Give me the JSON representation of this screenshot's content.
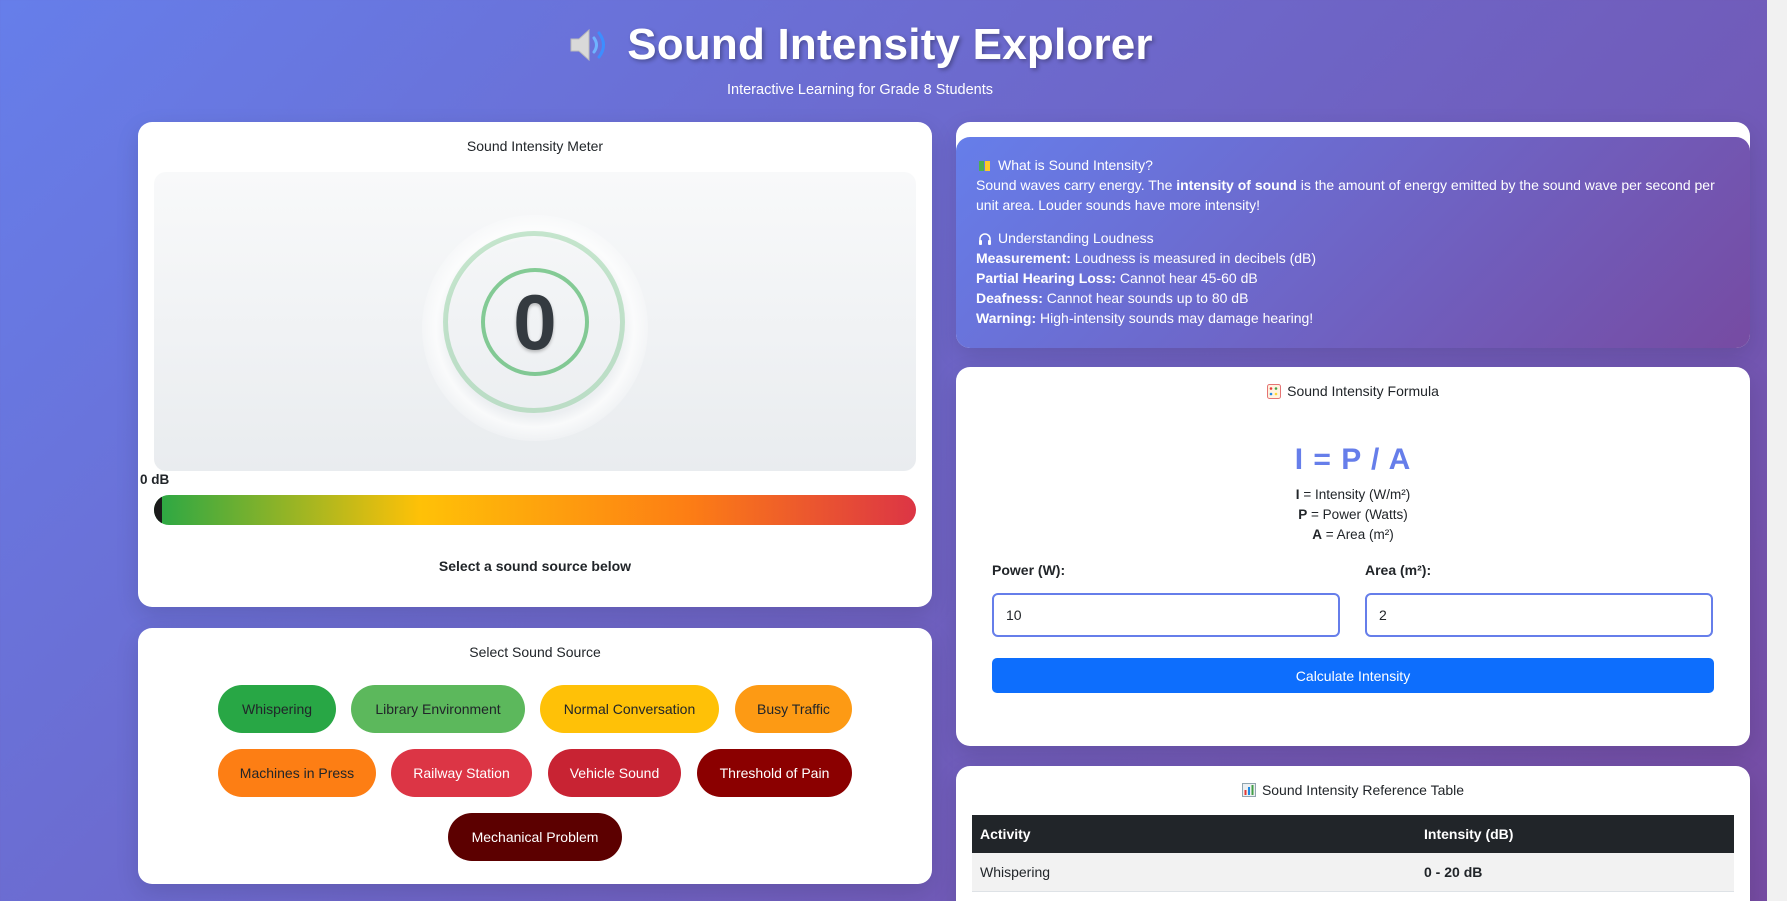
{
  "header": {
    "icon": "speaker-icon",
    "title": "Sound Intensity Explorer",
    "subtitle": "Interactive Learning for Grade 8 Students"
  },
  "meter": {
    "title": "Sound Intensity Meter",
    "value": "0",
    "db_label": "0 dB",
    "level_fraction": 0.0,
    "prompt": "Select a sound source below"
  },
  "sources": {
    "title": "Select Sound Source",
    "buttons": [
      {
        "label": "Whispering",
        "color": "#28a745",
        "text_color": "#212529"
      },
      {
        "label": "Library Environment",
        "color": "#5cb85c",
        "text_color": "#212529"
      },
      {
        "label": "Normal Conversation",
        "color": "#ffc107",
        "text_color": "#212529"
      },
      {
        "label": "Busy Traffic",
        "color": "#fd9a14",
        "text_color": "#212529"
      },
      {
        "label": "Machines in Press",
        "color": "#fd7e14",
        "text_color": "#212529"
      },
      {
        "label": "Railway Station",
        "color": "#dc3545",
        "text_color": "#ffffff"
      },
      {
        "label": "Vehicle Sound",
        "color": "#c82333",
        "text_color": "#ffffff"
      },
      {
        "label": "Threshold of Pain",
        "color": "#8b0000",
        "text_color": "#ffffff"
      },
      {
        "label": "Mechanical Problem",
        "color": "#5c0000",
        "text_color": "#ffffff"
      }
    ]
  },
  "info": {
    "what_heading": "What is Sound Intensity?",
    "what_text_1": "Sound waves carry energy. The ",
    "what_bold": "intensity of sound",
    "what_text_2": " is the amount of energy emitted by the sound wave per second per unit area. Louder sounds have more intensity!",
    "loudness_heading": "Understanding Loudness",
    "items": [
      {
        "label": "Measurement:",
        "text": " Loudness is measured in decibels (dB)"
      },
      {
        "label": "Partial Hearing Loss:",
        "text": " Cannot hear 45-60 dB"
      },
      {
        "label": "Deafness:",
        "text": " Cannot hear sounds up to 80 dB"
      },
      {
        "label": "Warning:",
        "text": " High-intensity sounds may damage hearing!"
      }
    ]
  },
  "formula": {
    "title": "Sound Intensity Formula",
    "equation": "I = P / A",
    "defs": [
      {
        "sym": "I",
        "text": " = Intensity (W/m²)"
      },
      {
        "sym": "P",
        "text": " = Power (Watts)"
      },
      {
        "sym": "A",
        "text": " = Area (m²)"
      }
    ],
    "power_label": "Power (W):",
    "area_label": "Area (m²):",
    "power_value": "10",
    "area_value": "2",
    "button_label": "Calculate Intensity"
  },
  "reference": {
    "title": "Sound Intensity Reference Table",
    "columns": [
      "Activity",
      "Intensity (dB)"
    ],
    "rows": [
      [
        "Whispering",
        "0 - 20 dB"
      ]
    ]
  }
}
